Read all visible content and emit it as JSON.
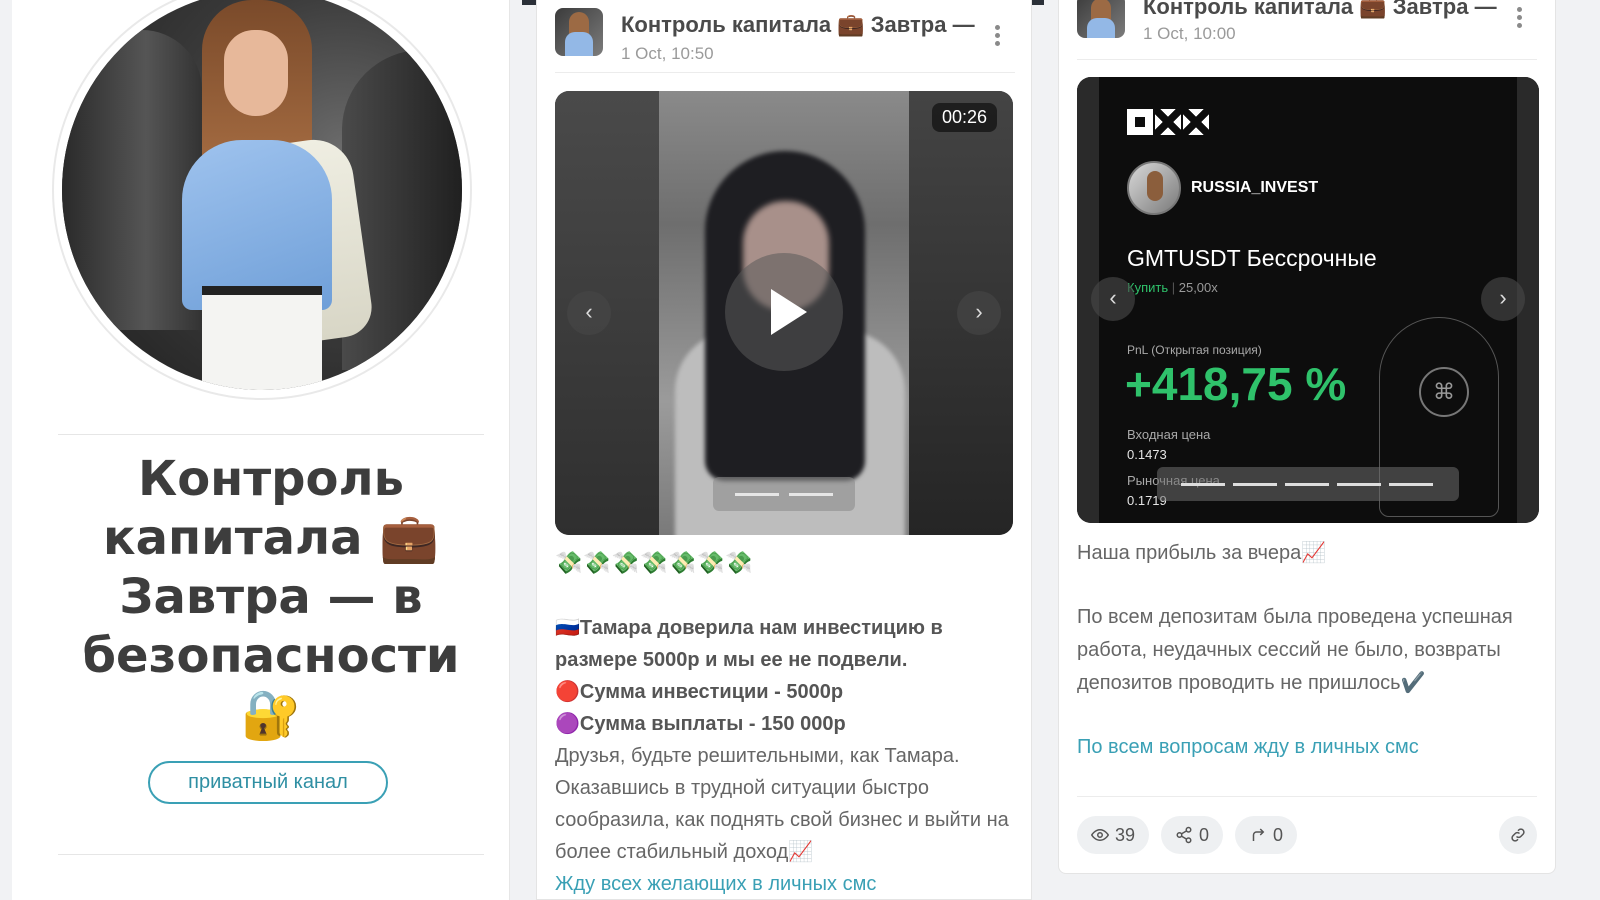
{
  "profile": {
    "title": "Контроль капитала 💼 Завтра — в безопасности 🔐",
    "private_button": "приватный канал"
  },
  "post_mid": {
    "title": "Контроль капитала 💼 Завтра —",
    "time": "1 Oct, 10:50",
    "video_duration": "00:26",
    "emoji_row": "💸💸💸💸💸💸💸",
    "line1": "🇷🇺Тамара доверила нам инвестицию в размере 5000р и мы ее не подвели.",
    "line2": "🔴Сумма инвестиции - 5000р",
    "line3": "🟣Сумма выплаты - 150 000р",
    "line4": "Друзья, будьте решительными, как Тамара. Оказавшись в трудной ситуации быстро сообразила, как поднять свой бизнес и выйти на более стабильный доход📈",
    "line5": "Жду всех желающих в личных смс"
  },
  "post_right": {
    "title": "Контроль капитала 💼 Завтра —",
    "time": "1 Oct, 10:00",
    "okx": {
      "username": "RUSSIA_INVEST",
      "pair": "GMTUSDT Бессрочные",
      "side": "Купить",
      "leverage": "25,00x",
      "pnl_label": "PnL (Открытая позиция)",
      "pnl": "+418,75 %",
      "entry_label": "Входная цена",
      "entry_value": "0.1473",
      "market_label": "Рыночная цена",
      "market_value": "0.1719"
    },
    "text1": "Наша прибыль за вчера📈",
    "text2": "По всем депозитам была проведена успешная работа, неудачных сессий не было, возвраты депозитов проводить не пришлось✔️",
    "text3": "По всем вопросам жду в личных смс",
    "views": "39",
    "shares": "0",
    "forwards": "0"
  },
  "icons": {
    "prev": "chevron-left-icon",
    "next": "chevron-right-icon",
    "play": "play-icon",
    "more": "kebab-icon",
    "views": "eye-icon",
    "share": "share-icon",
    "forward": "forward-icon",
    "link": "link-icon"
  },
  "colors": {
    "accent": "#3aa0b5",
    "pnl_green": "#2fc26b",
    "card_dark": "#0d0d0d"
  }
}
